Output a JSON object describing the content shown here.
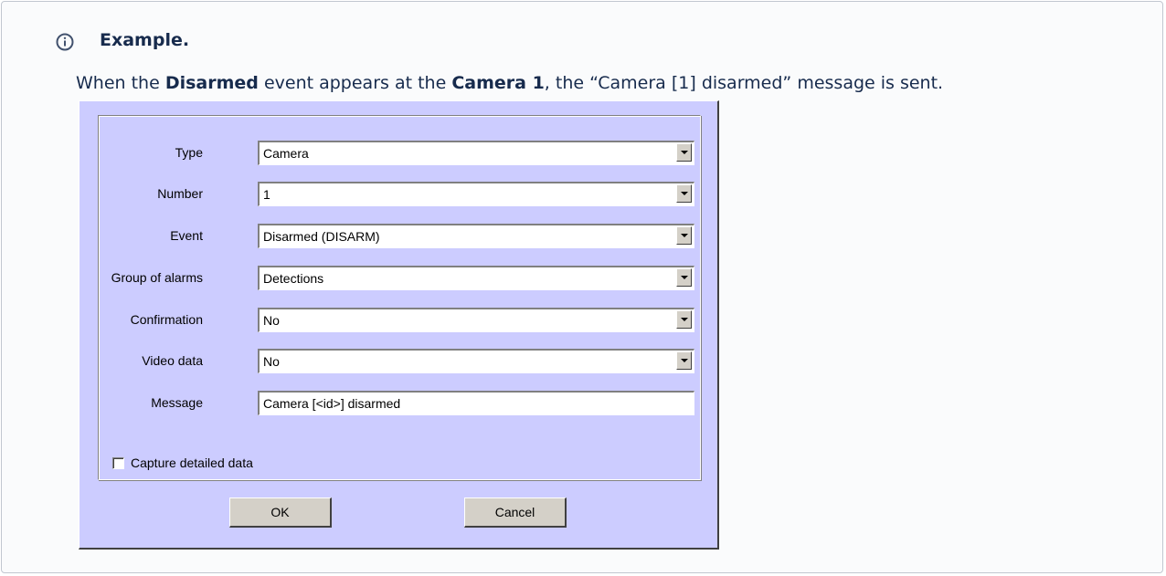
{
  "panel": {
    "title": "Example.",
    "text_parts": [
      "When the ",
      "Disarmed",
      " event appears at the ",
      "Camera 1",
      ", the “Camera [1] disarmed” message is sent."
    ]
  },
  "dialog": {
    "rows": [
      {
        "label": "Type",
        "value": "Camera",
        "kind": "combo"
      },
      {
        "label": "Number",
        "value": "1",
        "kind": "combo"
      },
      {
        "label": "Event",
        "value": "Disarmed (DISARM)",
        "kind": "combo"
      },
      {
        "label": "Group of alarms",
        "value": "Detections",
        "kind": "combo"
      },
      {
        "label": "Confirmation",
        "value": "No",
        "kind": "combo"
      },
      {
        "label": "Video data",
        "value": "No",
        "kind": "combo"
      },
      {
        "label": "Message",
        "value": "Camera [<id>] disarmed",
        "kind": "text"
      }
    ],
    "checkbox_label": "Capture detailed data",
    "checkbox_checked": false,
    "ok_label": "OK",
    "cancel_label": "Cancel"
  },
  "colors": {
    "dialog_bg": "#ccccff",
    "info_icon": "#42526e",
    "text": "#172b4d"
  },
  "icons": {
    "info": "info-circle-icon",
    "dropdown": "chevron-down-icon"
  }
}
